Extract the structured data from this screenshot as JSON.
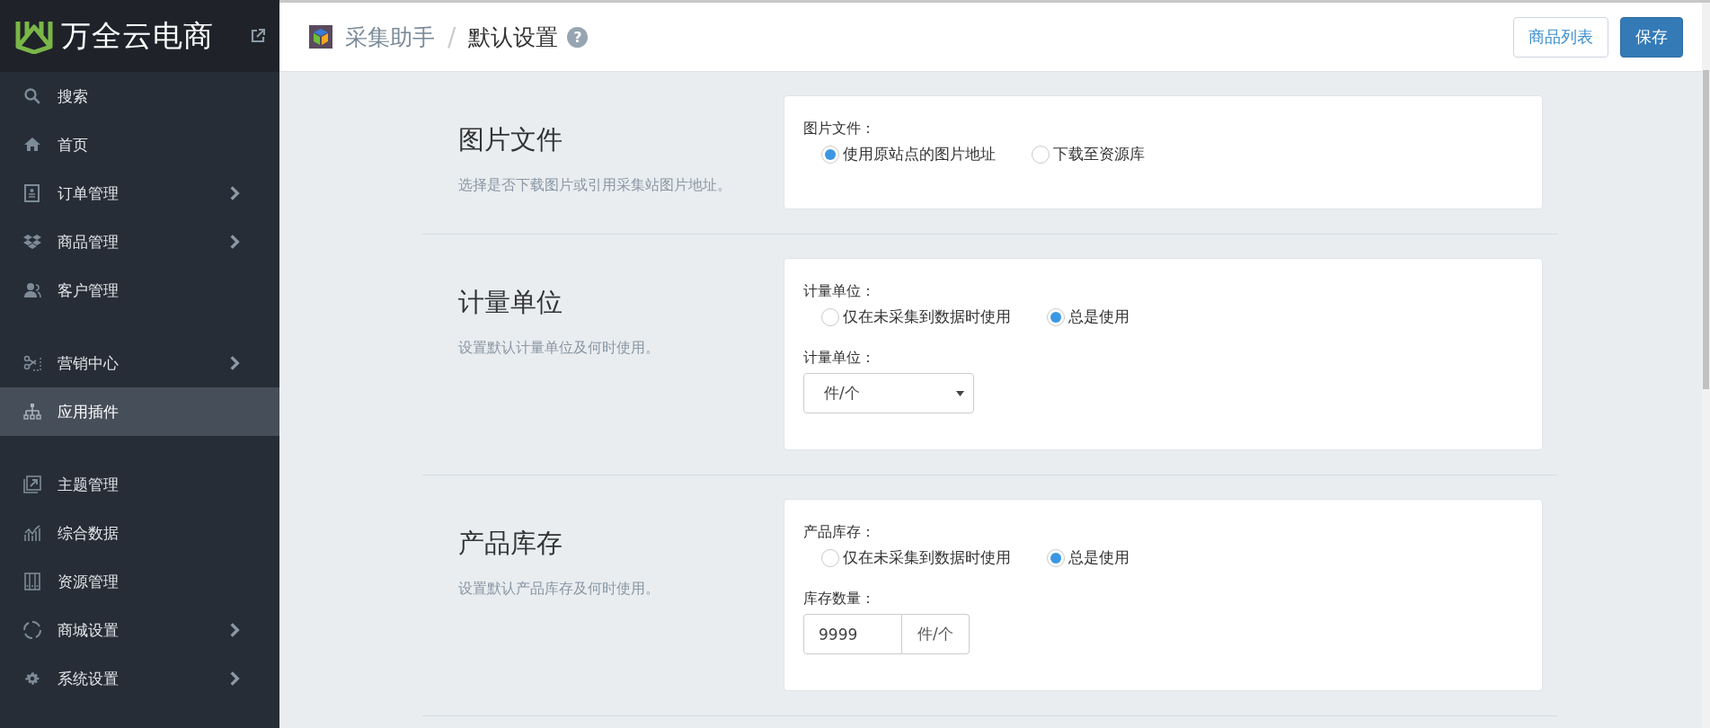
{
  "sidebar": {
    "brand": "万全云电商",
    "groups": [
      [
        {
          "label": "搜索",
          "has_submenu": false,
          "selected": false
        },
        {
          "label": "首页",
          "has_submenu": false,
          "selected": false
        },
        {
          "label": "订单管理",
          "has_submenu": true,
          "selected": false
        },
        {
          "label": "商品管理",
          "has_submenu": true,
          "selected": false
        },
        {
          "label": "客户管理",
          "has_submenu": false,
          "selected": false
        }
      ],
      [
        {
          "label": "营销中心",
          "has_submenu": true,
          "selected": false
        },
        {
          "label": "应用插件",
          "has_submenu": false,
          "selected": true
        }
      ],
      [
        {
          "label": "主题管理",
          "has_submenu": false,
          "selected": false
        },
        {
          "label": "综合数据",
          "has_submenu": false,
          "selected": false
        },
        {
          "label": "资源管理",
          "has_submenu": false,
          "selected": false
        },
        {
          "label": "商城设置",
          "has_submenu": true,
          "selected": false
        },
        {
          "label": "系统设置",
          "has_submenu": true,
          "selected": false
        }
      ]
    ]
  },
  "header": {
    "breadcrumb": [
      "采集助手",
      "默认设置"
    ],
    "separator": "/",
    "help": "?",
    "buttons": [
      {
        "label": "商品列表",
        "kind": "default"
      },
      {
        "label": "保存",
        "kind": "primary"
      }
    ]
  },
  "sections": [
    {
      "title": "图片文件",
      "description": "选择是否下载图片或引用采集站图片地址。",
      "fields": [
        {
          "kind": "radio",
          "label": "图片文件：",
          "options": [
            {
              "label": "使用原站点的图片地址",
              "selected": true
            },
            {
              "label": "下载至资源库",
              "selected": false
            }
          ]
        }
      ]
    },
    {
      "title": "计量单位",
      "description": "设置默认计量单位及何时使用。",
      "fields": [
        {
          "kind": "radio",
          "label": "计量单位：",
          "options": [
            {
              "label": "仅在未采集到数据时使用",
              "selected": false
            },
            {
              "label": "总是使用",
              "selected": true
            }
          ]
        },
        {
          "kind": "select",
          "label": "计量单位：",
          "value": "件/个"
        }
      ]
    },
    {
      "title": "产品库存",
      "description": "设置默认产品库存及何时使用。",
      "fields": [
        {
          "kind": "radio",
          "label": "产品库存：",
          "options": [
            {
              "label": "仅在未采集到数据时使用",
              "selected": false
            },
            {
              "label": "总是使用",
              "selected": true
            }
          ]
        },
        {
          "kind": "input",
          "label": "库存数量：",
          "value": "9999",
          "addon": "件/个"
        }
      ]
    }
  ]
}
